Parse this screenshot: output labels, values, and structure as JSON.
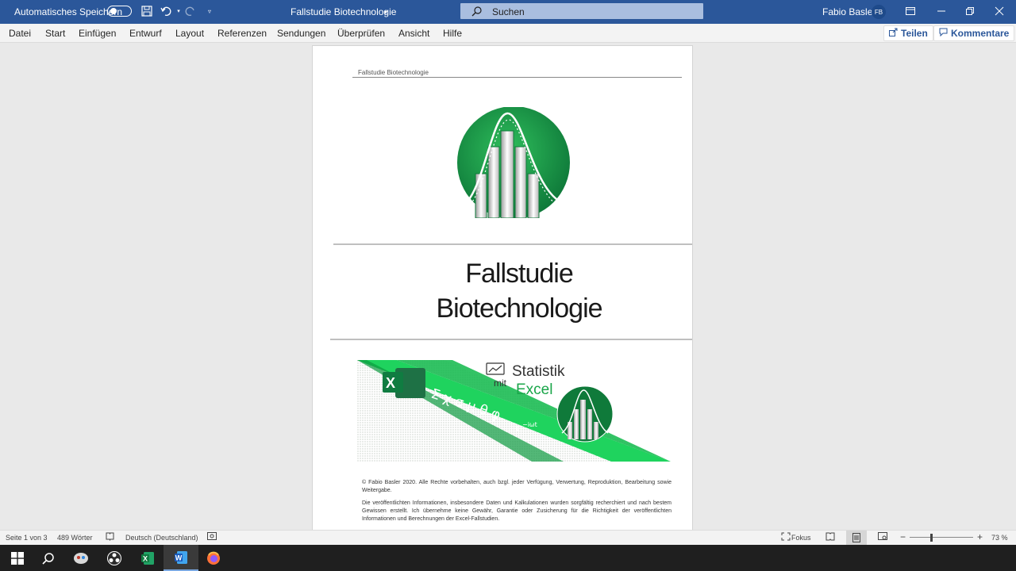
{
  "titlebar": {
    "autosave_label": "Automatisches Speichern",
    "document_title": "Fallstudie Biotechnologie",
    "search_placeholder": "Suchen",
    "user_name": "Fabio Basler",
    "user_initials": "FB"
  },
  "ribbon": {
    "tabs": [
      "Datei",
      "Start",
      "Einfügen",
      "Entwurf",
      "Layout",
      "Referenzen",
      "Sendungen",
      "Überprüfen",
      "Ansicht",
      "Hilfe"
    ],
    "share_label": "Teilen",
    "comments_label": "Kommentare"
  },
  "page": {
    "header_text": "Fallstudie Biotechnologie",
    "title_line1": "Fallstudie",
    "title_line2": "Biotechnologie",
    "banner": {
      "statistik": "Statistik",
      "mit": "mit",
      "excel": "Excel",
      "symbols": "Σ χ σ μ θ φ",
      "exponent_base": "e",
      "exponent": "−iωt"
    },
    "legal_1": "© Fabio Basler 2020. Alle Rechte vorbehalten, auch bzgl. jeder Verfügung, Verwertung, Reproduktion, Bearbeitung sowie Weitergabe.",
    "legal_2": "Die veröffentlichten Informationen, insbesondere Daten und Kalkulationen wurden sorgfältig recherchiert und nach bestem Gewissen erstellt. Ich übernehme keine Gewähr, Garantie oder Zusicherung für die Richtigkeit der veröffentlichten Informationen und Berechnungen der Excel-Fallstudien."
  },
  "status": {
    "page": "Seite 1 von 3",
    "words": "489 Wörter",
    "language": "Deutsch (Deutschland)",
    "focus": "Fokus",
    "zoom": "73 %"
  },
  "colors": {
    "word_blue": "#2b579a",
    "brand_green": "#1aa64a",
    "dark_green": "#0f7a3a"
  }
}
